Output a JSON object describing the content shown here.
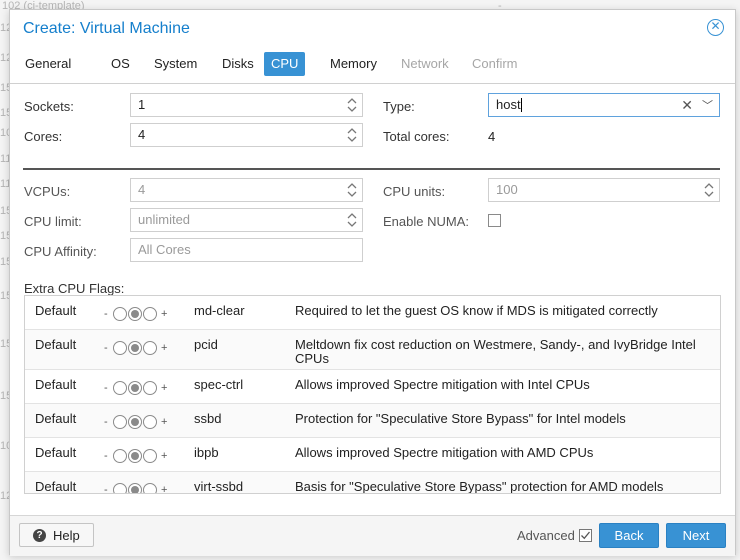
{
  "background": {
    "rows": [
      "102 (ci-template)",
      "12",
      "12",
      "15",
      "15",
      "10",
      "11",
      "11",
      "15",
      "15",
      "15",
      "15",
      "15",
      "15",
      "10",
      "12"
    ],
    "dash": "-"
  },
  "dialog": {
    "title": "Create: Virtual Machine",
    "close_icon": "close-circle-icon"
  },
  "tabs": [
    {
      "label": "General",
      "state": "normal"
    },
    {
      "label": "OS",
      "state": "normal"
    },
    {
      "label": "System",
      "state": "normal"
    },
    {
      "label": "Disks",
      "state": "normal"
    },
    {
      "label": "CPU",
      "state": "active"
    },
    {
      "label": "Memory",
      "state": "normal"
    },
    {
      "label": "Network",
      "state": "disabled"
    },
    {
      "label": "Confirm",
      "state": "disabled"
    }
  ],
  "form": {
    "sockets": {
      "label": "Sockets:",
      "value": "1"
    },
    "cores": {
      "label": "Cores:",
      "value": "4"
    },
    "type": {
      "label": "Type:",
      "value": "host"
    },
    "total_cores": {
      "label": "Total cores:",
      "value": "4"
    },
    "vcpus": {
      "label": "VCPUs:",
      "value": "4"
    },
    "cpu_units": {
      "label": "CPU units:",
      "value": "100"
    },
    "cpu_limit": {
      "label": "CPU limit:",
      "value": "unlimited"
    },
    "enable_numa": {
      "label": "Enable NUMA:",
      "checked": false
    },
    "cpu_affinity": {
      "label": "CPU Affinity:",
      "placeholder": "All Cores"
    }
  },
  "extra_flags": {
    "label": "Extra CPU Flags:",
    "rows": [
      {
        "state": "Default",
        "minus": "-",
        "plus": "+",
        "flag": "md-clear",
        "desc": "Required to let the guest OS know if MDS is mitigated correctly"
      },
      {
        "state": "Default",
        "minus": "-",
        "plus": "+",
        "flag": "pcid",
        "desc": "Meltdown fix cost reduction on Westmere, Sandy-, and IvyBridge Intel",
        "desc2": "CPUs"
      },
      {
        "state": "Default",
        "minus": "-",
        "plus": "+",
        "flag": "spec-ctrl",
        "desc": "Allows improved Spectre mitigation with Intel CPUs"
      },
      {
        "state": "Default",
        "minus": "-",
        "plus": "+",
        "flag": "ssbd",
        "desc": "Protection for \"Speculative Store Bypass\" for Intel models"
      },
      {
        "state": "Default",
        "minus": "-",
        "plus": "+",
        "flag": "ibpb",
        "desc": "Allows improved Spectre mitigation with AMD CPUs"
      },
      {
        "state": "Default",
        "minus": "-",
        "plus": "+",
        "flag": "virt-ssbd",
        "desc": "Basis for \"Speculative Store Bypass\" protection for AMD models"
      }
    ]
  },
  "footer": {
    "help_label": "Help",
    "help_icon": "question-circle-icon",
    "advanced_label": "Advanced",
    "advanced_checked": true,
    "back_label": "Back",
    "next_label": "Next"
  },
  "colors": {
    "accent": "#3892d4",
    "title": "#157fcc"
  }
}
